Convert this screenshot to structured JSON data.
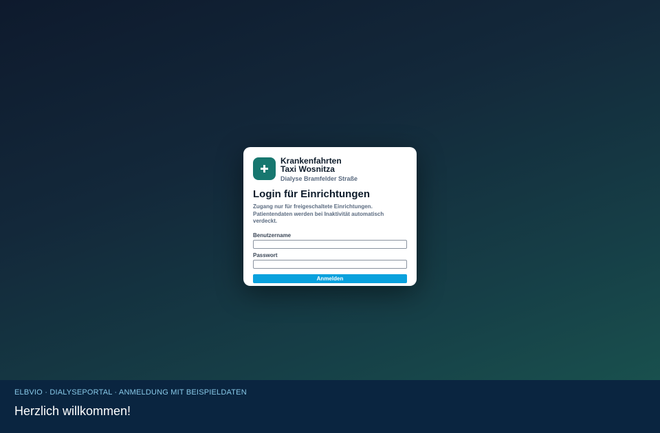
{
  "brand": {
    "icon": "plus-icon",
    "name": "Krankenfahrten Taxi Wosnitza",
    "subtitle": "Dialyse Bramfelder Straße",
    "accent_color": "#17776f"
  },
  "login": {
    "title": "Login für Einrichtungen",
    "description": "Zugang nur für freigeschaltete Einrichtungen. Patientendaten werden bei Inaktivität automatisch verdeckt.",
    "username_label": "Benutzername",
    "username_value": "",
    "password_label": "Passwort",
    "password_value": "",
    "submit_label": "Anmelden",
    "button_color": "#09a1dd"
  },
  "footer": {
    "breadcrumb": "ELBVIO · DIALYSEPORTAL · ANMELDUNG MIT BEISPIELDATEN",
    "welcome": "Herzlich willkommen!",
    "background_color": "#0a2540"
  }
}
